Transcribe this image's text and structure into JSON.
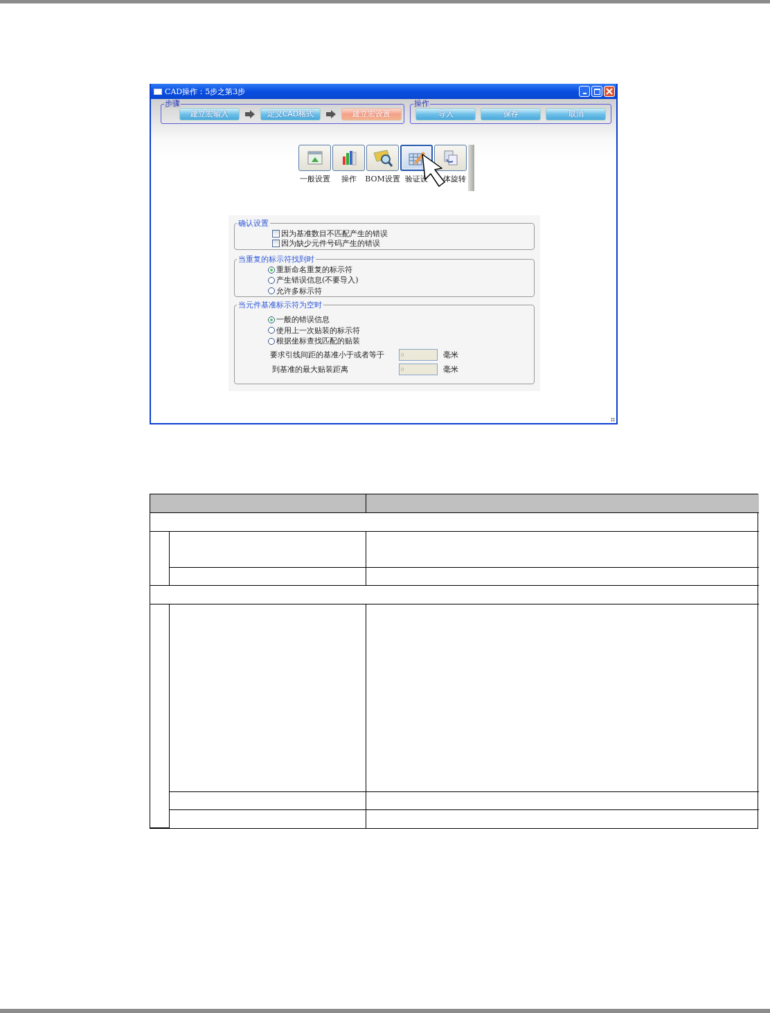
{
  "window": {
    "title": "CAD操作：5步之第3步"
  },
  "steps": {
    "legend": "步骤",
    "buttons": [
      {
        "label": "建立宏输入",
        "selected": false
      },
      {
        "label": "定义CAD格式",
        "selected": false
      },
      {
        "label": "建立宏设置",
        "selected": true
      }
    ]
  },
  "operations": {
    "legend": "操作",
    "buttons": [
      "导入",
      "保存",
      "取消"
    ]
  },
  "toolbar": [
    {
      "kind": "general",
      "label": "一般设置",
      "selected": false
    },
    {
      "kind": "chart",
      "label": "操作",
      "selected": false
    },
    {
      "kind": "map",
      "label": "BOM设置",
      "selected": false
    },
    {
      "kind": "edit",
      "label": "验证设",
      "selected": true
    },
    {
      "kind": "rotate",
      "label": "体旋转",
      "selected": false
    }
  ],
  "confirm": {
    "legend": "确认设置",
    "options": [
      {
        "label": "因为基准数目不匹配产生的错误",
        "checked": false
      },
      {
        "label": "因为缺少元件号码产生的错误",
        "checked": false
      }
    ]
  },
  "duplicate": {
    "legend": "当重复的标示符找到时",
    "options": [
      {
        "label": "重新命名重复的标示符",
        "selected": true
      },
      {
        "label": "产生错误信息(不要导入)",
        "selected": false
      },
      {
        "label": "允许多标示符",
        "selected": false
      }
    ]
  },
  "empty_ref": {
    "legend": "当元件基准标示符为空时",
    "options": [
      {
        "label": "一般的错误信息",
        "selected": true
      },
      {
        "label": "使用上一次贴装的标示符",
        "selected": false
      },
      {
        "label": "根据坐标查找匹配的贴装",
        "selected": false
      }
    ],
    "fields": [
      {
        "label": "要求引线间距的基准小于或者等于",
        "value": "0",
        "unit": "毫米"
      },
      {
        "label": "到基准的最大贴装距离",
        "value": "0",
        "unit": "毫米"
      }
    ]
  }
}
